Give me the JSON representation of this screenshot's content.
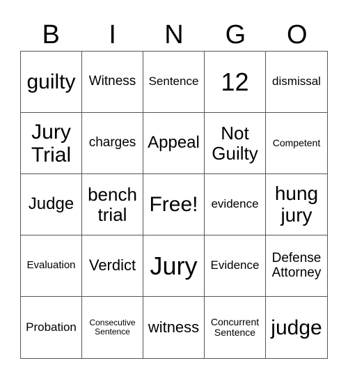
{
  "header": [
    "B",
    "I",
    "N",
    "G",
    "O"
  ],
  "cells": [
    {
      "text": "guilty",
      "size": "s30"
    },
    {
      "text": "Witness",
      "size": "s19"
    },
    {
      "text": "Sentence",
      "size": "s17"
    },
    {
      "text": "12",
      "size": "s36"
    },
    {
      "text": "dismissal",
      "size": "s17"
    },
    {
      "text": "Jury Trial",
      "size": "s30"
    },
    {
      "text": "charges",
      "size": "s19"
    },
    {
      "text": "Appeal",
      "size": "s24"
    },
    {
      "text": "Not Guilty",
      "size": "s26"
    },
    {
      "text": "Competent",
      "size": "s14"
    },
    {
      "text": "Judge",
      "size": "s24"
    },
    {
      "text": "bench trial",
      "size": "s26"
    },
    {
      "text": "Free!",
      "size": "s30"
    },
    {
      "text": "evidence",
      "size": "s17"
    },
    {
      "text": "hung jury",
      "size": "s28"
    },
    {
      "text": "Evaluation",
      "size": "s15"
    },
    {
      "text": "Verdict",
      "size": "s22"
    },
    {
      "text": "Jury",
      "size": "s36"
    },
    {
      "text": "Evidence",
      "size": "s17"
    },
    {
      "text": "Defense Attorney",
      "size": "s19"
    },
    {
      "text": "Probation",
      "size": "s17"
    },
    {
      "text": "Consecutive Sentence",
      "size": "s12"
    },
    {
      "text": "witness",
      "size": "s22"
    },
    {
      "text": "Concurrent Sentence",
      "size": "s14"
    },
    {
      "text": "judge",
      "size": "s30"
    }
  ]
}
